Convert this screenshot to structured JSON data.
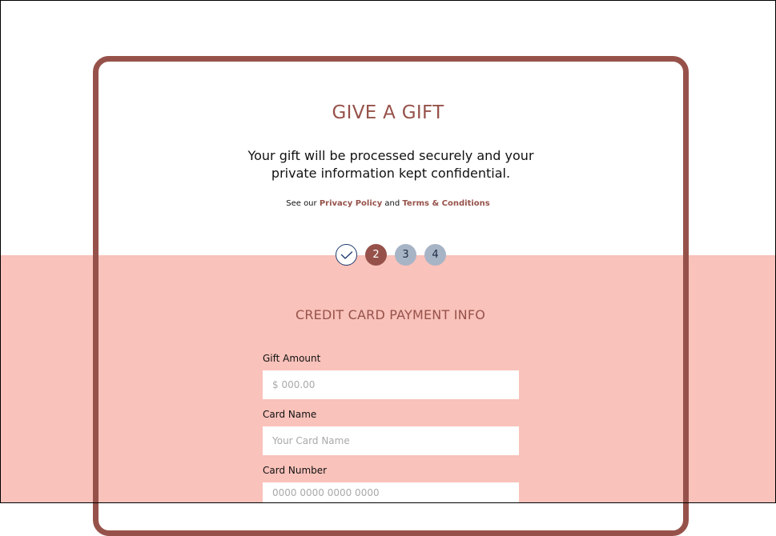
{
  "page": {
    "title": "GIVE A GIFT",
    "subtitle": "Your gift will be processed securely and your private information kept confidential.",
    "policy": {
      "prefix": "See our",
      "privacy_link": "Privacy Policy",
      "joiner": "and",
      "terms_link": "Terms & Conditions"
    }
  },
  "stepper": {
    "steps": [
      {
        "label": "",
        "state": "done",
        "icon": "check-icon"
      },
      {
        "label": "2",
        "state": "active"
      },
      {
        "label": "3",
        "state": "pending"
      },
      {
        "label": "4",
        "state": "pending"
      }
    ]
  },
  "form": {
    "section_title": "CREDIT CARD PAYMENT INFO",
    "fields": [
      {
        "label": "Gift Amount",
        "placeholder": "$ 000.00",
        "value": ""
      },
      {
        "label": "Card Name",
        "placeholder": "Your Card Name",
        "value": ""
      },
      {
        "label": "Card Number",
        "placeholder": "0000 0000 0000 0000",
        "value": ""
      }
    ]
  },
  "colors": {
    "accent": "#96524a",
    "band": "#f9c2ba",
    "step_pending": "#a7b4c6",
    "step_done_border": "#1f3a6e"
  }
}
